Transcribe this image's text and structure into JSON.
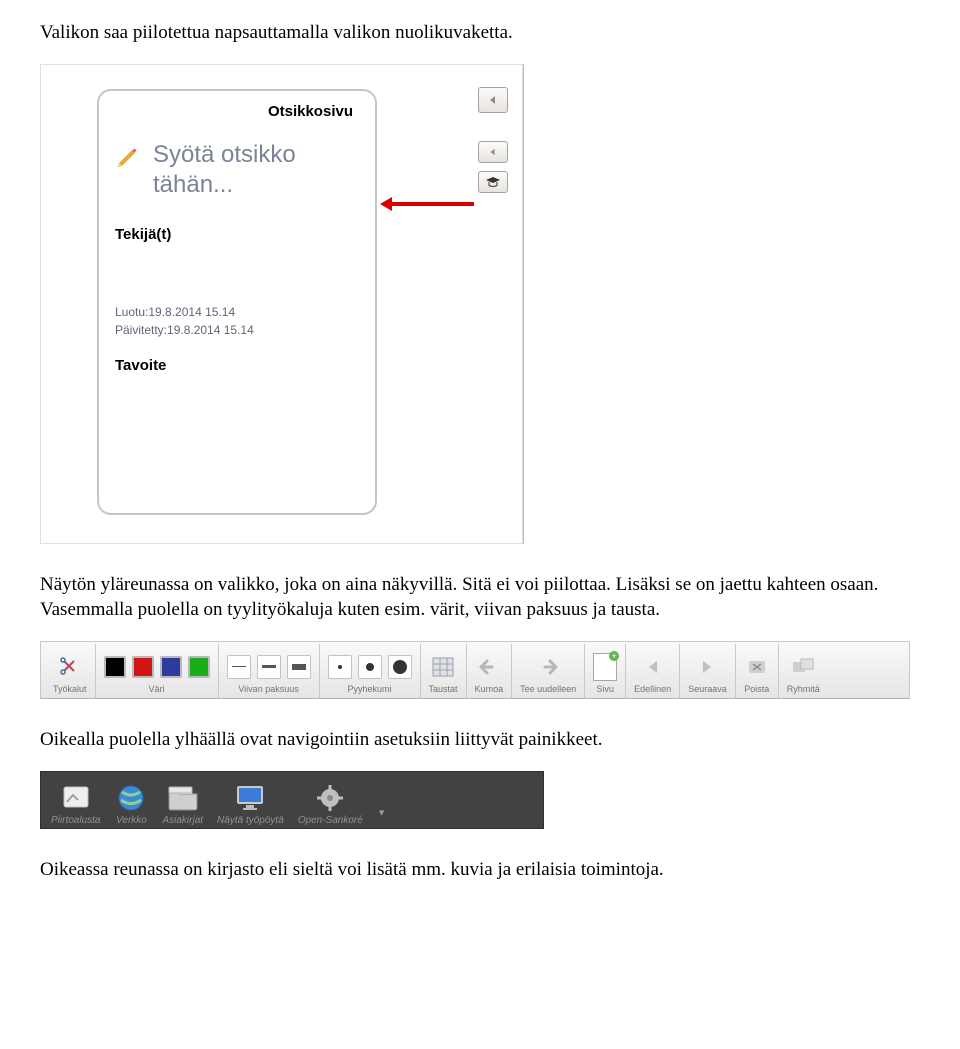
{
  "para1": "Valikon saa piilotettua napsauttamalla valikon nuolikuvaketta.",
  "para2": "Näytön yläreunassa on valikko, joka on aina näkyvillä. Sitä ei voi piilottaa. Lisäksi se on jaettu kahteen osaan. Vasemmalla puolella on tyylityökaluja kuten esim. värit, viivan paksuus ja tausta.",
  "para3": "Oikealla puolella ylhäällä ovat navigointiin asetuksiin liittyvät painikkeet.",
  "para4": "Oikeassa reunassa on kirjasto eli sieltä voi lisätä mm. kuvia ja erilaisia toimintoja.",
  "shot1": {
    "page_title": "Otsikkosivu",
    "placeholder": "Syötä otsikko tähän...",
    "authors_label": "Tekijä(t)",
    "created": "Luotu:19.8.2014 15.14",
    "updated": "Päivitetty:19.8.2014 15.14",
    "goal_label": "Tavoite"
  },
  "toolbar": {
    "tools": "Työkalut",
    "color": "Väri",
    "line": "Viivan paksuus",
    "eraser": "Pyyhekumi",
    "bg": "Taustat",
    "undo": "Kumoa",
    "redo": "Tee uudelleen",
    "page": "Sivu",
    "prev": "Edellinen",
    "next": "Seuraava",
    "del": "Poista",
    "group": "Ryhmitä",
    "colors": {
      "black": "#000000",
      "red": "#d11515",
      "blue": "#2d3b9e",
      "green": "#1aad1a"
    }
  },
  "nav": {
    "board": "Piirtoalusta",
    "web": "Verkko",
    "docs": "Asiakirjat",
    "desktop": "Näytä työpöytä",
    "app": "Open-Sankoré"
  }
}
